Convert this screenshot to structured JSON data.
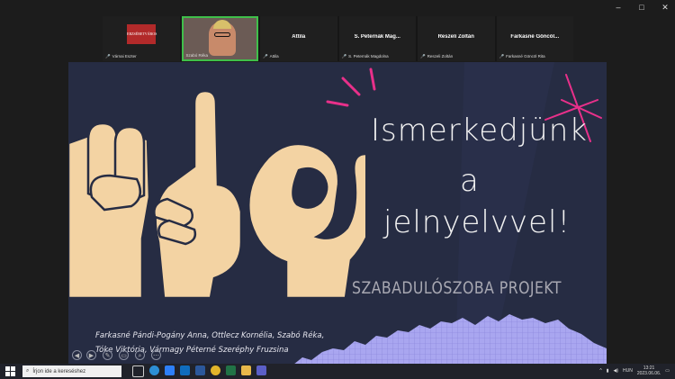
{
  "window_controls": {
    "minimize": "–",
    "maximize": "□",
    "close": "✕"
  },
  "gallery": [
    {
      "name": "",
      "label": "Várnai Eszter",
      "muted": true,
      "type": "logo",
      "logo_text": "ERZSÉBETVÁROS"
    },
    {
      "name": "",
      "label": "Szabó Réka",
      "muted": false,
      "type": "video"
    },
    {
      "name": "Attila",
      "label": "Attila",
      "muted": true
    },
    {
      "name": "S. Peternák Mag...",
      "label": "S. Peternák Magdolna",
      "muted": true
    },
    {
      "name": "Reszeli Zoltán",
      "label": "Reszeli Zoltán",
      "muted": true
    },
    {
      "name": "Farkasné Göncöl...",
      "label": "Farkasné Göncöl Rita",
      "muted": true
    }
  ],
  "slide": {
    "title_lines": [
      "Ismerkedjünk",
      "a",
      "jelnyelvvel!"
    ],
    "subtitle": "SZABADULÓSZOBA PROJEKT",
    "authors": [
      "Farkasné Pándi-Pogány Anna, Ottlecz Kornélia, Szabó Réka,",
      "Tóke Viktória, Vármagy Péterné Szeréphy Fruzsina"
    ],
    "colors": {
      "background": "#262c43",
      "skin": "#f3d3a3",
      "accent": "#e8308a",
      "wave": "#a9a6f0"
    }
  },
  "presenter_controls": [
    "◀",
    "▶",
    "✎",
    "▭",
    "⌕",
    "⋯"
  ],
  "taskbar": {
    "search_placeholder": "Írjon ide a kereséshez",
    "apps": [
      "task-view-icon",
      "edge-icon",
      "zoom-icon",
      "outlook-icon",
      "word-icon",
      "chrome-icon",
      "excel-icon",
      "explorer-icon",
      "teams-icon"
    ],
    "tray": {
      "language": "HUN",
      "time": "13:21",
      "date": "2023.06.06."
    }
  }
}
